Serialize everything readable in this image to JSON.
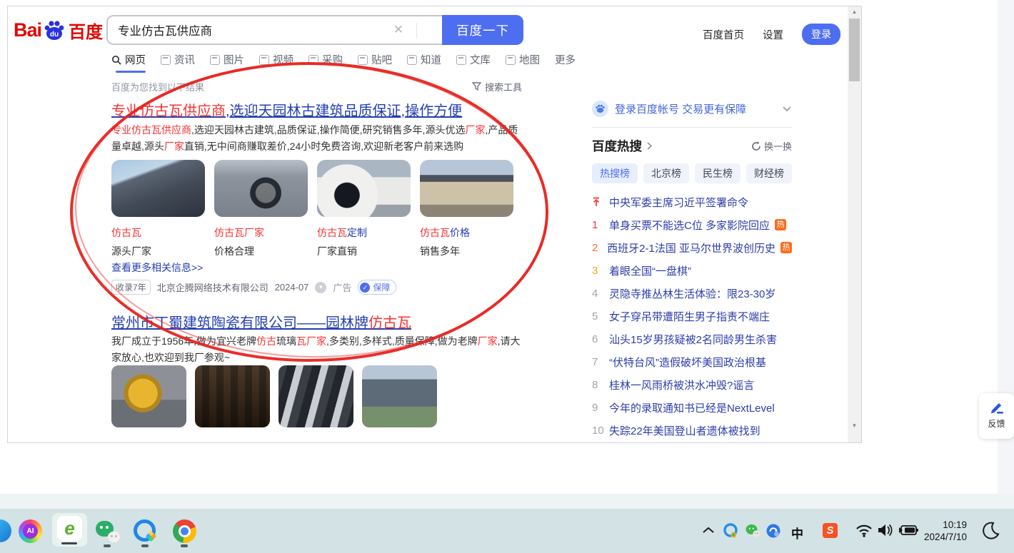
{
  "glyphs": {
    "close": "✕",
    "up_arrow": "▲",
    "down_arrow": "▼",
    "down_small": "▾",
    "check": "✓"
  },
  "colors": {
    "accent_blue": "#4e6ef2",
    "link_blue": "#2440b3",
    "em_red": "#f73131",
    "hot_orange": "#fe6b1c",
    "rank1": "#fe2d46",
    "rank2": "#ff6f26",
    "rank3": "#faa116"
  },
  "header": {
    "logo": {
      "bai": "Bai",
      "du": "du",
      "baidu_cn": "百度"
    },
    "search": {
      "value": "专业仿古瓦供应商",
      "button_label": "百度一下"
    },
    "links": {
      "home": "百度首页",
      "settings": "设置",
      "login": "登录"
    }
  },
  "nav": {
    "items": [
      {
        "label": "网页"
      },
      {
        "label": "资讯"
      },
      {
        "label": "图片"
      },
      {
        "label": "视频"
      },
      {
        "label": "采购"
      },
      {
        "label": "贴吧"
      },
      {
        "label": "知道"
      },
      {
        "label": "文库"
      },
      {
        "label": "地图"
      },
      {
        "label": "更多"
      }
    ]
  },
  "meta": {
    "found_text": "百度为您找到以下结果",
    "tools_label": "搜索工具"
  },
  "results": {
    "r1": {
      "title": {
        "em": "专业仿古瓦供应商",
        "rest": ",选迎天园林古建筑品质保证,操作方便"
      },
      "desc": {
        "s0": "专业仿古瓦供应商",
        "s1": ",选迎天园林古建筑,品质保证,操作简便,研究销售多年,源头优选",
        "s2": "厂家",
        "s3": ",产品质量卓越,源头",
        "s4": "厂家",
        "s5": "直销,无中间商赚取差价,24小时免费咨询,欢迎新老客户前来选购"
      },
      "cards": [
        {
          "photo": "traditional-tile-roof-photo",
          "line1_em": "仿古瓦",
          "line1_rest": "",
          "line2": "源头厂家"
        },
        {
          "photo": "brick-gate-circle-photo",
          "line1_em": "仿古瓦厂家",
          "line1_rest": "",
          "line2": "价格合理"
        },
        {
          "photo": "moon-gate-courtyard-photo",
          "line1_em": "仿古瓦",
          "line1_rest": "定制",
          "line2": "厂家直销"
        },
        {
          "photo": "stone-archway-photo",
          "line1_em": "仿古瓦",
          "line1_rest": "价格",
          "line2": "销售多年"
        }
      ],
      "more_link": "查看更多相关信息>>",
      "source": {
        "badge": "收录7年",
        "company": "北京企腾网络技术有限公司",
        "date": "2024-07",
        "ad_label": "广告",
        "protect_label": "保障"
      }
    },
    "r2": {
      "title": {
        "main": "常州市丁蜀建筑陶瓷有限公司——园林牌",
        "em": "仿古瓦"
      },
      "desc": {
        "s0": "我厂成立于1956年,做为宜兴老牌",
        "s1": "仿古",
        "s2": "琉璃",
        "s3": "瓦厂家",
        "s4": ",多类别,多样式,质量保障,做为老牌",
        "s5": "厂家",
        "s6": ",请大家放心,也欢迎到我厂参观~"
      },
      "photos": [
        "golden-finial-photo",
        "tile-warehouse-photo",
        "clay-tiles-floor-photo",
        "temple-roof-photo"
      ]
    }
  },
  "sidebar": {
    "login_banner": {
      "text": "登录百度帐号 交易更有保障"
    },
    "hot": {
      "title": "百度热搜",
      "refresh_label": "换一换",
      "hot_badge": "热",
      "tabs": [
        {
          "label": "热搜榜"
        },
        {
          "label": "北京榜"
        },
        {
          "label": "民生榜"
        },
        {
          "label": "财经榜"
        }
      ],
      "items": [
        {
          "rank": "top",
          "text": "中央军委主席习近平签署命令"
        },
        {
          "rank": "1",
          "text": "单身买票不能选C位 多家影院回应",
          "hot": true
        },
        {
          "rank": "2",
          "text": "西班牙2-1法国 亚马尔世界波创历史",
          "hot": true
        },
        {
          "rank": "3",
          "text": "着眼全国“一盘棋”"
        },
        {
          "rank": "4",
          "text": "灵隐寺推丛林生活体验：限23-30岁"
        },
        {
          "rank": "5",
          "text": "女子穿吊带遭陌生男子指责不端庄"
        },
        {
          "rank": "6",
          "text": "汕头15岁男孩疑被2名同龄男生杀害"
        },
        {
          "rank": "7",
          "text": "“伏特台风”造假破坏美国政治根基"
        },
        {
          "rank": "8",
          "text": "桂林一风雨桥被洪水冲毁?谣言"
        },
        {
          "rank": "9",
          "text": "今年的录取通知书已经是NextLevel"
        },
        {
          "rank": "10",
          "text": "失踪22年美国登山者遗体被找到"
        }
      ]
    }
  },
  "feedback": {
    "label": "反馈"
  },
  "taskbar": {
    "clock": {
      "time": "10:19",
      "date": "2024/7/10"
    },
    "input_method": "中",
    "sogou_letter": "S",
    "ai_label": "AI",
    "e360_letter": "e"
  }
}
